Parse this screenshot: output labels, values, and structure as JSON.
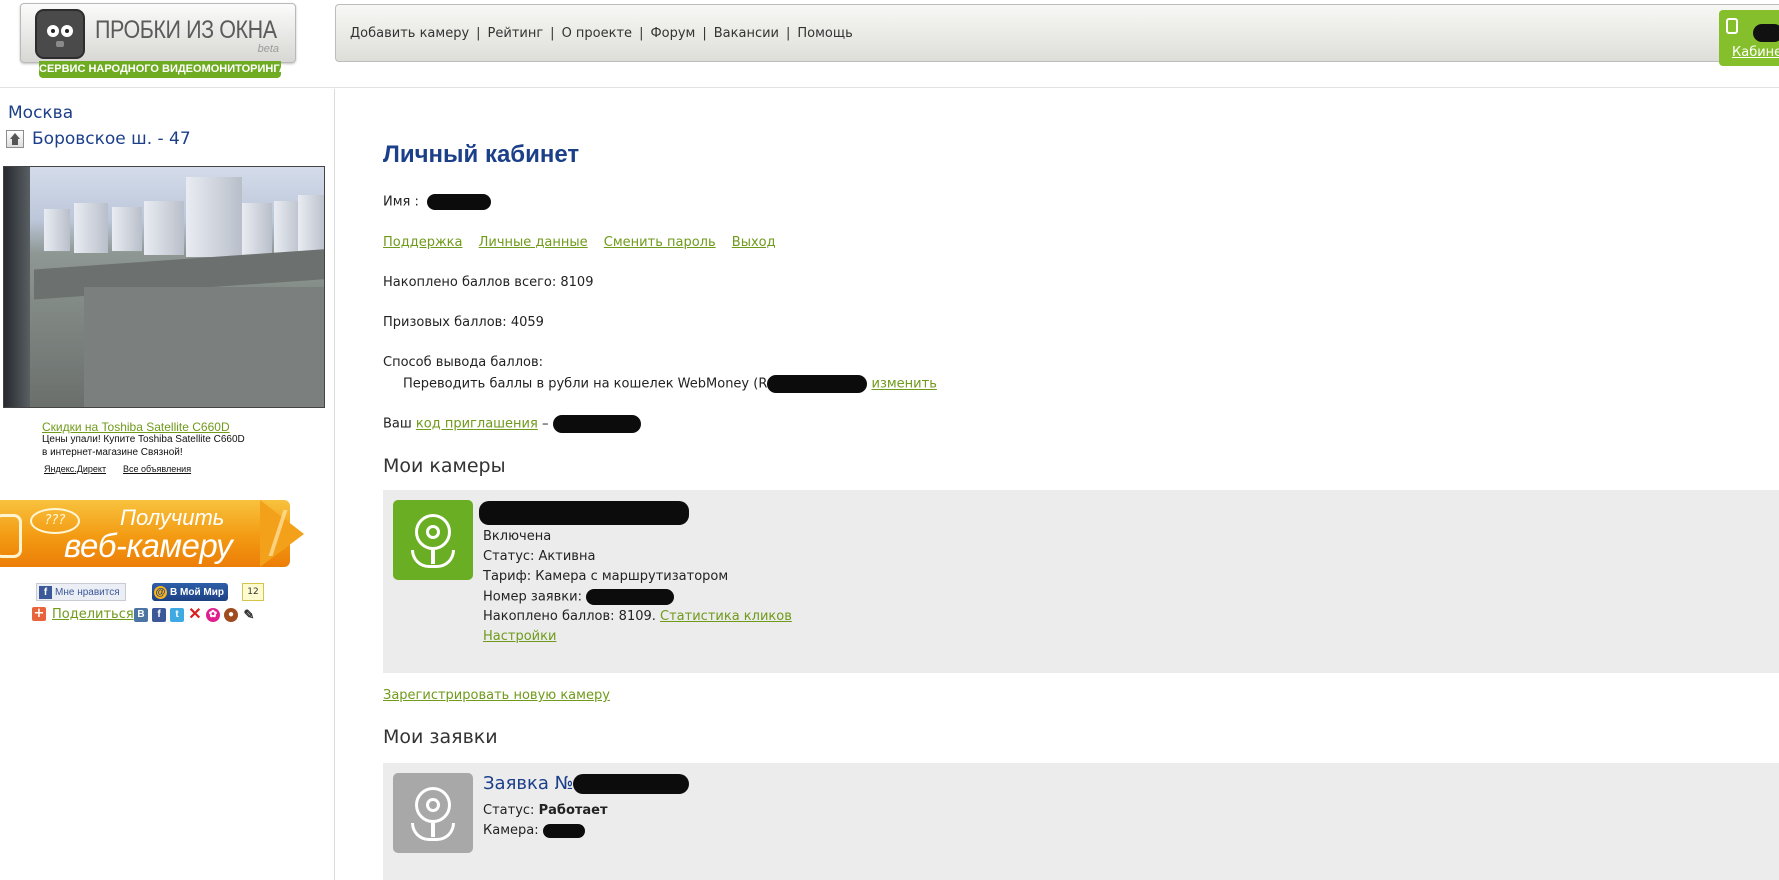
{
  "header": {
    "logo_title": "ПРОБКИ ИЗ ОКНА",
    "logo_beta": "beta",
    "logo_subtitle": "СЕРВИС НАРОДНОГО ВИДЕОМОНИТОРИНГА",
    "nav": [
      "Добавить камеру",
      "Рейтинг",
      "О проекте",
      "Форум",
      "Вакансии",
      "Помощь"
    ],
    "nav_separator": "|",
    "cabinet_label": "Кабинет"
  },
  "sidebar": {
    "city": "Москва",
    "camera_address": "Боровское ш. - 47",
    "ad": {
      "link": "Скидки на Toshiba Satellite C660D",
      "text_line1": "Цены упали! Купите Toshiba Satellite C660D",
      "text_line2": "в интернет-магазине Связной!",
      "yandex": "Яндекс.Директ",
      "all_ads": "Все объявления"
    },
    "banner": {
      "bubble": "???",
      "line1": "Получить",
      "line2": "веб-камеру"
    },
    "social": {
      "like_label": "Мне нравится",
      "myworld_label": "В Мой Мир",
      "myworld_count": "12",
      "share_label": "Поделиться",
      "share_icons": [
        "vk-icon",
        "facebook-icon",
        "twitter-icon",
        "x-icon",
        "flower-icon",
        "bear-icon",
        "pencil-icon"
      ]
    }
  },
  "main": {
    "title": "Личный кабинет",
    "name_label": "Имя :",
    "links": [
      "Поддержка",
      "Личные данные",
      "Сменить пароль",
      "Выход"
    ],
    "total_points": "Накоплено баллов всего: 8109",
    "prize_points": "Призовых баллов: 4059",
    "withdraw_label": "Способ вывода баллов:",
    "withdraw_text": "Переводить баллы в рубли на кошелек WebMoney (R",
    "withdraw_change": "изменить",
    "invite_prefix": "Ваш",
    "invite_link": "код приглашения",
    "invite_dash": "–",
    "my_cameras_title": "Мои камеры",
    "camera": {
      "state": "Включена",
      "status": "Статус: Активна",
      "tariff": "Тариф: Камера с маршрутизатором",
      "request_label": "Номер заявки:",
      "points": "Накоплено баллов: 8109.",
      "stats_link": "Статистика кликов",
      "settings_link": "Настройки",
      "icon_color": "#6aae24"
    },
    "register_link": "Зарегистрировать новую камеру",
    "my_requests_title": "Мои заявки",
    "request": {
      "title": "Заявка №",
      "status_label": "Статус:",
      "status_value": "Работает",
      "camera_label": "Камера:",
      "icon_color": "#a8a8a8"
    }
  }
}
